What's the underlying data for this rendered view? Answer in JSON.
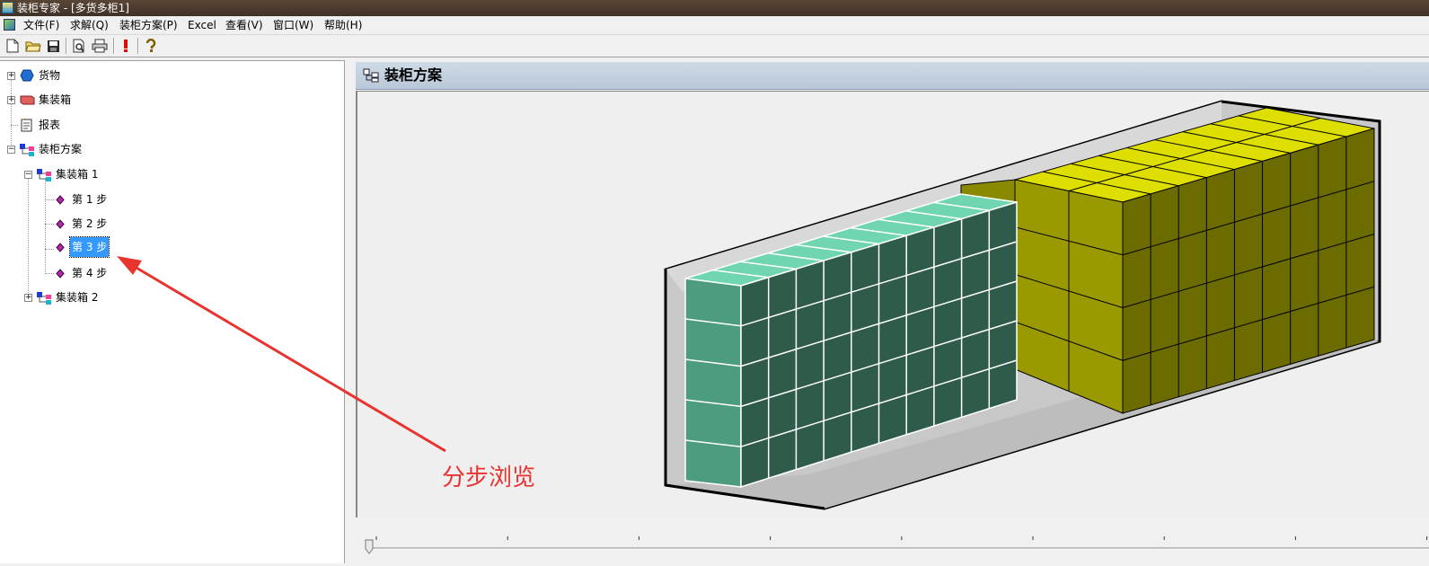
{
  "window": {
    "title": "装柜专家 - [多货多柜1]"
  },
  "menubar": {
    "items": [
      "文件(F)",
      "求解(Q)",
      "装柜方案(P)",
      "Excel",
      "查看(V)",
      "窗口(W)",
      "帮助(H)"
    ]
  },
  "toolbar": {
    "buttons": [
      "new-file-icon",
      "open-folder-icon",
      "save-icon",
      "print-preview-icon",
      "print-icon",
      "solve-icon",
      "help-icon"
    ]
  },
  "tree": {
    "goods": "货物",
    "containers": "集装箱",
    "report": "报表",
    "plan": "装柜方案",
    "container1": "集装箱 1",
    "steps": [
      "第 1 步",
      "第 2 步",
      "第 3 步",
      "第 4 步"
    ],
    "selected_step": "第 3 步",
    "container2": "集装箱 2"
  },
  "panel": {
    "title": "装柜方案"
  },
  "annotation": {
    "text": "分步浏览",
    "color": "#e8332e"
  },
  "colors": {
    "teal_front": "#4d9c7e",
    "teal_side": "#2e5b4a",
    "teal_top": "#6fd6b0",
    "yellow_front": "#9a9a00",
    "yellow_side": "#6b6b00",
    "yellow_top": "#dede00",
    "selection": "#3399ff"
  }
}
